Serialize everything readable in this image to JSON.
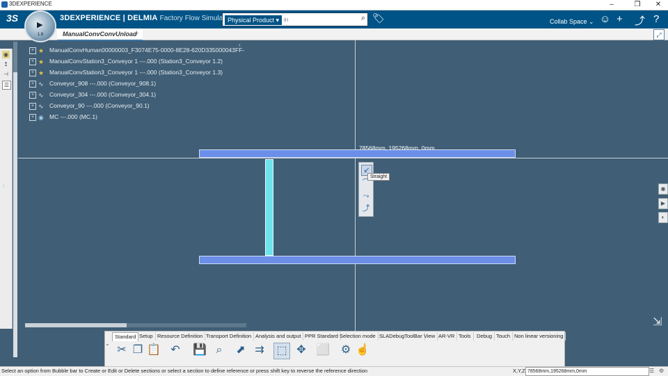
{
  "os_window": {
    "title": "3DEXPERIENCE",
    "minimize_glyph": "–",
    "restore_glyph": "❒",
    "close_glyph": "✕"
  },
  "header": {
    "brand_bold": "3DEXPERIENCE | DELMIA",
    "brand_app": "Factory Flow Simulation",
    "compass_version": "1.8",
    "search_scope": "Physical Product ▾",
    "search_placeholder": "in",
    "collab_space": "Collab Space ⌄",
    "icons": {
      "ds_logo": "3S",
      "search": "⌕",
      "tag": "🏷",
      "user": "☺",
      "add": "+",
      "share": "⤴",
      "help": "?"
    }
  },
  "tabs": {
    "active": "ManualConvConvUnload",
    "add": "+"
  },
  "tree": {
    "collapse_glyph": "‹",
    "items": [
      {
        "label": "ManualConvHuman00000003_F3074E75-0000-8E28-620D335000043FF-",
        "icon": "★",
        "kind": "resource"
      },
      {
        "label": "ManualConvStation3_Conveyor 1 ---.000 (Station3_Conveyor 1.2)",
        "icon": "★",
        "kind": "resource"
      },
      {
        "label": "ManualConvStation3_Conveyor 1 ---.000 (Station3_Conveyor 1.3)",
        "icon": "★",
        "kind": "resource"
      },
      {
        "label": "Conveyor_908 ---.000 (Conveyor_908.1)",
        "icon": "∿",
        "kind": "conv"
      },
      {
        "label": "Conveyor_304 ---.000 (Conveyor_304.1)",
        "icon": "∿",
        "kind": "conv"
      },
      {
        "label": "Conveyor_90 ---.000 (Conveyor_90.1)",
        "icon": "∿",
        "kind": "conv"
      },
      {
        "label": "MC ---.000 (MC.1)",
        "icon": "◉",
        "kind": "mc"
      }
    ]
  },
  "canvas": {
    "cursor_coordinates": "78568mm, 195268mm, 0mm",
    "tooltip": "Straight",
    "bubble_bar": [
      "↙",
      "⌒",
      "⤳",
      "⤴"
    ]
  },
  "action_bar": {
    "sections": [
      "Standard",
      "Setup",
      "Resource Definition",
      "Transport Definition",
      "Analysis and output",
      "PPR Standard",
      "Selection mode",
      "SLADebugToolBar",
      "View",
      "AR-VR",
      "Tools",
      "Debug",
      "Touch",
      "Non linear versioning"
    ],
    "active_section": "Standard",
    "tools": [
      {
        "name": "cut",
        "glyph": "✂"
      },
      {
        "name": "copy",
        "glyph": "❐"
      },
      {
        "name": "paste",
        "glyph": "📋"
      },
      {
        "name": "undo",
        "glyph": "↶"
      },
      {
        "name": "save",
        "glyph": "💾"
      },
      {
        "name": "search",
        "glyph": "⌕"
      },
      {
        "name": "conveyor",
        "glyph": "⬈"
      },
      {
        "name": "conveyor-flow",
        "glyph": "⇉"
      },
      {
        "name": "sketch",
        "glyph": "⬚"
      },
      {
        "name": "manipulator",
        "glyph": "✥"
      },
      {
        "name": "bounding-box",
        "glyph": "⬜"
      },
      {
        "name": "robot",
        "glyph": "⚙"
      },
      {
        "name": "hand",
        "glyph": "☝"
      }
    ]
  },
  "status": {
    "message": "Select an option from Bubble bar to Create or Edit or Delete sections or select a section to define reference or press shift key to reverse the reference direction",
    "xyz_label": "X,Y,Z",
    "xyz_value": "78568mm,195268mm,0mm"
  }
}
